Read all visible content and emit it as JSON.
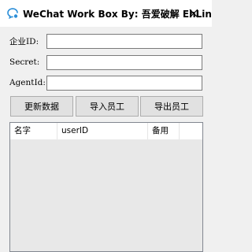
{
  "window": {
    "title": "WeChat Work Box  By:  吾爱破解  EhLin"
  },
  "form": {
    "corp_id_label": "企业ID:",
    "corp_id_value": "",
    "secret_label": "Secret:",
    "secret_value": "",
    "agent_id_label": "AgentId:",
    "agent_id_value": ""
  },
  "toolbar": {
    "update_label": "更新数据",
    "import_label": "导入员工",
    "export_label": "导出员工"
  },
  "list": {
    "columns": [
      "名字",
      "userID",
      "备用"
    ],
    "rows": []
  },
  "colors": {
    "icon_blue": "#2b8ed8",
    "window_bg": "#f0f0f0"
  }
}
